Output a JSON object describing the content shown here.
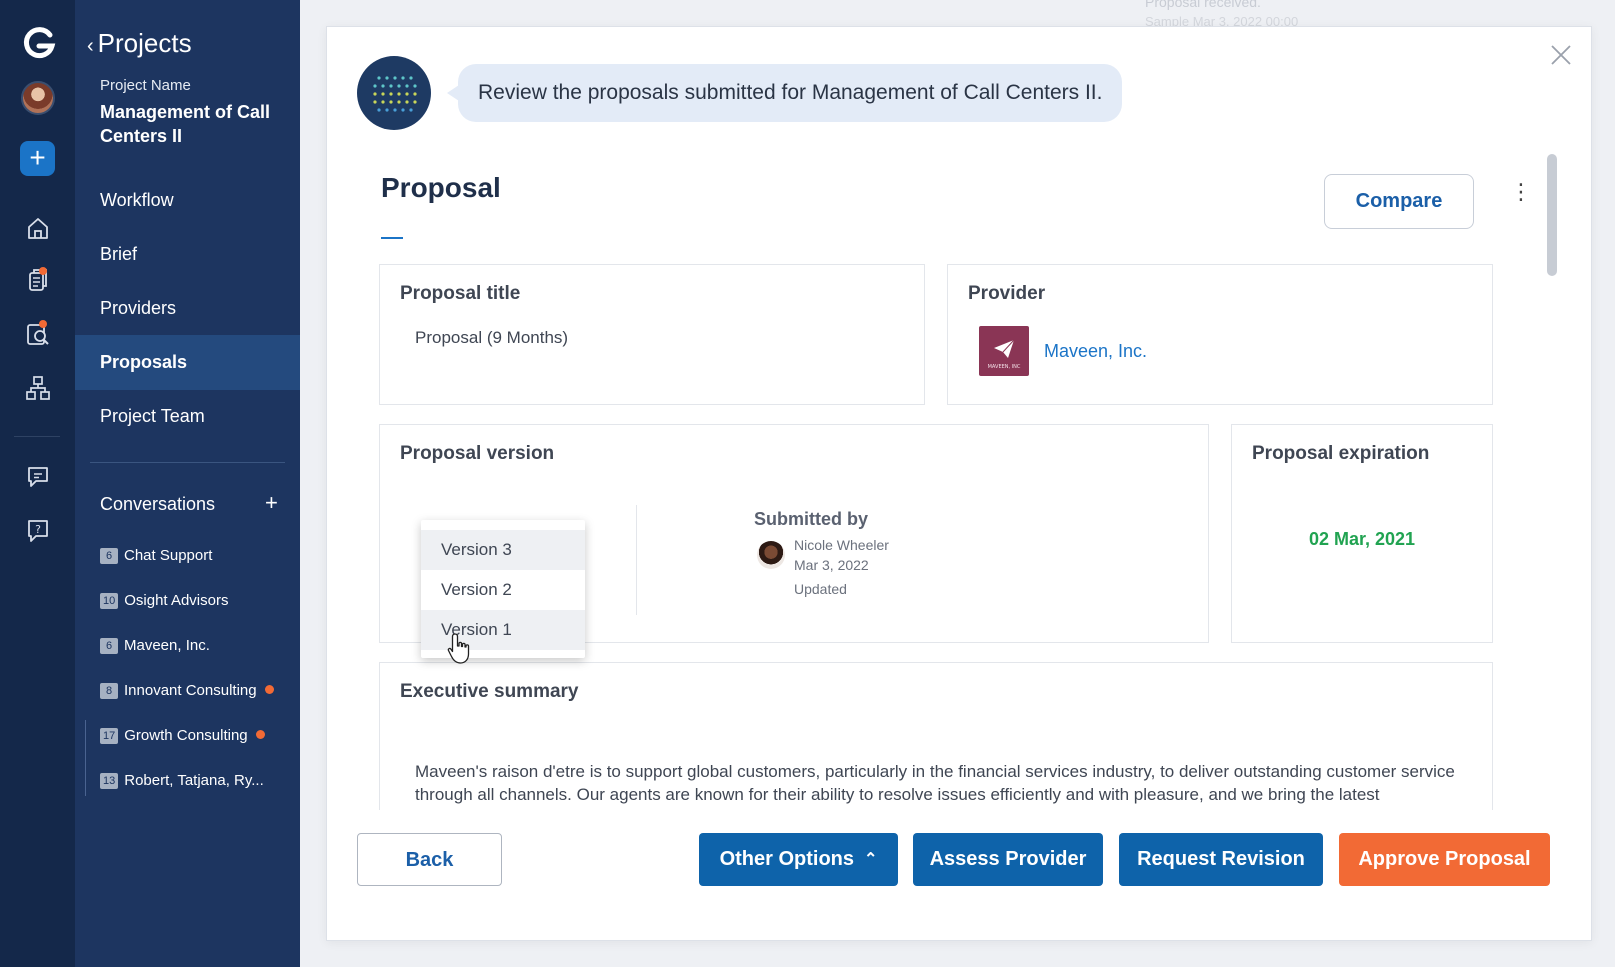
{
  "rail": {
    "icons": [
      "logo-icon",
      "avatar",
      "add-icon",
      "home-icon",
      "documents-icon",
      "search-document-icon",
      "org-chart-icon",
      "messages-icon",
      "help-icon"
    ]
  },
  "sidebar": {
    "back_label": "Projects",
    "project_name_label": "Project Name",
    "project_name": "Management of Call Centers II",
    "nav": [
      {
        "label": "Workflow"
      },
      {
        "label": "Brief"
      },
      {
        "label": "Providers"
      },
      {
        "label": "Proposals",
        "active": true
      },
      {
        "label": "Project Team"
      }
    ],
    "conversations_label": "Conversations",
    "conversations_add": "+",
    "conversations": [
      {
        "count": "6",
        "name": "Chat Support",
        "unread": false
      },
      {
        "count": "10",
        "name": "Osight Advisors",
        "unread": false
      },
      {
        "count": "6",
        "name": "Maveen, Inc.",
        "unread": false
      },
      {
        "count": "8",
        "name": "Innovant Consulting",
        "unread": true
      },
      {
        "count": "17",
        "name": "Growth Consulting",
        "unread": true
      },
      {
        "count": "13",
        "name": "Robert, Tatjana, Ry...",
        "unread": false
      }
    ]
  },
  "background": {
    "ghost_line1": "Proposal received.",
    "ghost_line2": "Sample Mar 3, 2022 00:00"
  },
  "modal": {
    "assistant_message": "Review the proposals submitted for Management of Call Centers II.",
    "title": "Proposal",
    "compare_label": "Compare",
    "more_label": "⋮",
    "proposal_title_label": "Proposal title",
    "proposal_title_value": "Proposal (9 Months)",
    "provider_label": "Provider",
    "provider_name": "Maveen, Inc.",
    "provider_logo_text": "MAVEEN, INC",
    "version_label": "Proposal version",
    "version_options": [
      "Version 3",
      "Version 2",
      "Version 1"
    ],
    "submitted_by_label": "Submitted by",
    "submitter_name": "Nicole Wheeler",
    "submitted_date": "Mar 3, 2022",
    "submission_status": "Updated",
    "expiration_label": "Proposal expiration",
    "expiration_date": "02 Mar, 2021",
    "exec_summary_label": "Executive summary",
    "exec_summary_text": "Maveen's raison d'etre is to support global customers, particularly in the financial services industry, to deliver outstanding customer service through all channels. Our agents are known for their ability to resolve issues efficiently and with pleasure, and we bring the latest technologies to bear, in order to support the ever-evolving customer needs of the people and businesses our clients serve."
  },
  "footer": {
    "back_label": "Back",
    "other_options_label": "Other Options",
    "assess_label": "Assess Provider",
    "revision_label": "Request Revision",
    "approve_label": "Approve Proposal"
  },
  "colors": {
    "rail": "#14284a",
    "sidebar": "#1d3560",
    "sidebar_active": "#244a7e",
    "primary_button": "#0e63aa",
    "approve_button": "#f26a35",
    "expiration_green": "#21a351",
    "link_blue": "#1b74c7"
  }
}
